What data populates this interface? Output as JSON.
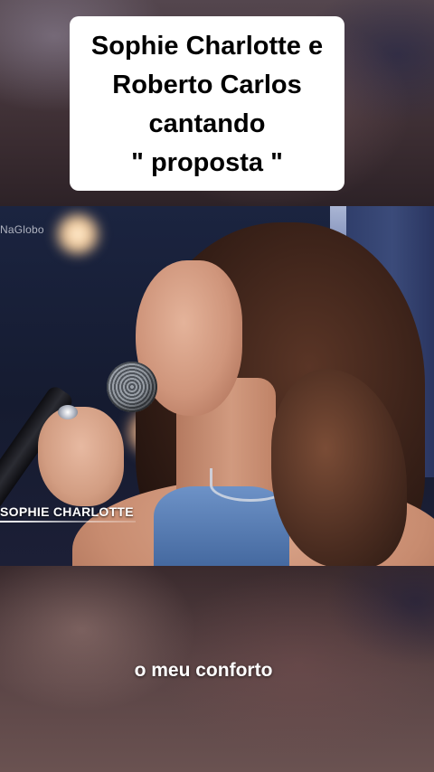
{
  "title": {
    "lines": [
      "Sophie Charlotte e",
      "Roberto Carlos",
      "cantando",
      "\" proposta \""
    ]
  },
  "video": {
    "channel_logo": "NaGlobo",
    "name_tag": "SOPHIE CHARLOTTE"
  },
  "subtitle": "o meu conforto"
}
